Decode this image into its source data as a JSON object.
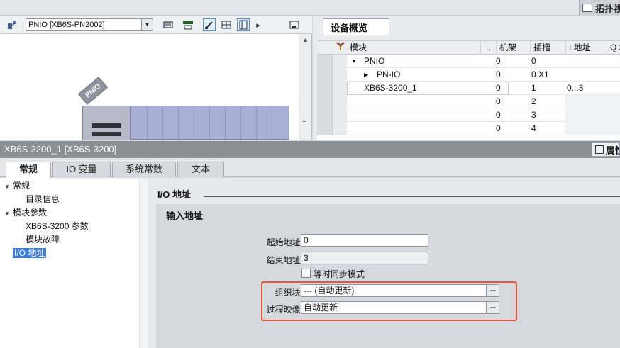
{
  "topology_tab": {
    "label": "拓扑视图"
  },
  "network_view": {
    "device_select": {
      "value": "PNIO [XB6S-PN2002]"
    },
    "device_label": "PNIO"
  },
  "device_overview": {
    "tab_label": "设备概览",
    "columns": {
      "module": "模块",
      "dots": "...",
      "rack": "机架",
      "slot": "插槽",
      "i_address": "I 地址",
      "q_address": "Q 地"
    },
    "rows": [
      {
        "module": "PNIO",
        "expand": "▼",
        "rack": "0",
        "slot": "0",
        "i_address": ""
      },
      {
        "module": "PN-IO",
        "expand": "▶",
        "rack": "0",
        "slot": "0 X1",
        "i_address": ""
      },
      {
        "module": "XB6S-3200_1",
        "expand": "",
        "rack": "0",
        "slot": "1",
        "i_address": "0...3"
      },
      {
        "module": "",
        "expand": "",
        "rack": "0",
        "slot": "2",
        "i_address": ""
      },
      {
        "module": "",
        "expand": "",
        "rack": "0",
        "slot": "3",
        "i_address": ""
      },
      {
        "module": "",
        "expand": "",
        "rack": "0",
        "slot": "4",
        "i_address": ""
      }
    ]
  },
  "properties": {
    "title": "XB6S-3200_1 [XB6S-3200]",
    "button_label": "属性",
    "tabs": [
      "常规",
      "IO 变量",
      "系统常数",
      "文本"
    ]
  },
  "nav": {
    "items": [
      {
        "label": "常规",
        "arrow": "▼"
      },
      {
        "label": "目录信息",
        "arrow": ""
      },
      {
        "label": "模块参数",
        "arrow": "▼"
      },
      {
        "label": "XB6S-3200 参数",
        "arrow": ""
      },
      {
        "label": "模块故障",
        "arrow": ""
      },
      {
        "label": "I/O 地址",
        "arrow": ""
      }
    ]
  },
  "content": {
    "section_title": "I/O 地址",
    "group_title": "输入地址",
    "start_address": {
      "label": "起始地址:",
      "value": "0"
    },
    "end_address": {
      "label": "结束地址:",
      "value": "3"
    },
    "isochronous": {
      "label": "等时同步模式"
    },
    "org_block": {
      "label": "组织块:",
      "value": "--- (自动更新)",
      "button": "..."
    },
    "process_image": {
      "label": "过程映像:",
      "value": "自动更新",
      "button": "..."
    }
  },
  "colors": {
    "highlight": "#e8543e",
    "selection": "#3d7bd6",
    "title_bar": "#8a8f96"
  }
}
